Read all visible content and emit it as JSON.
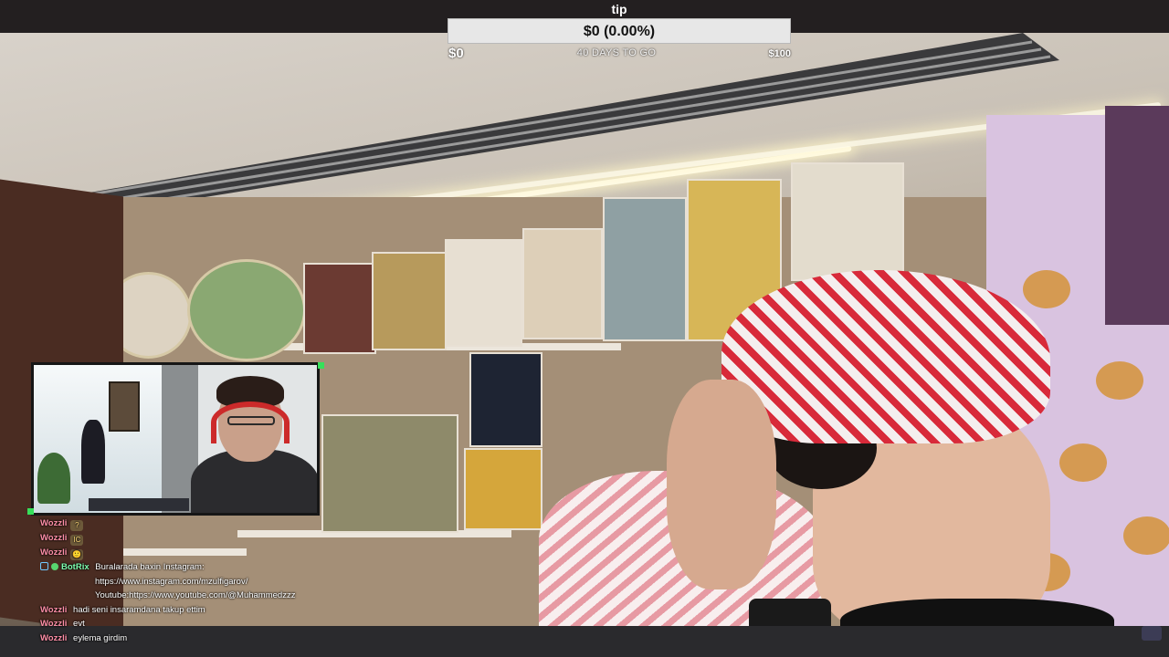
{
  "tip_goal": {
    "title": "tip",
    "progress_text": "$0 (0.00%)",
    "progress_fraction": 0.0,
    "start_label": "$0",
    "days_label": "40 DAYS TO GO",
    "goal_label": "$100",
    "bar_fill_color": "#8f8fff"
  },
  "webcam": {
    "border_accent_color": "#36e05a"
  },
  "chat": {
    "messages": [
      {
        "user": "Wozzli",
        "text": "",
        "emote": "?"
      },
      {
        "user": "Wozzli",
        "text": "",
        "emote": "IC"
      },
      {
        "user": "Wozzli",
        "text": "",
        "emote": "🙂"
      },
      {
        "user": "BotRix",
        "text": "Buralarada baxin Instagram:",
        "is_bot": true
      },
      {
        "user": "",
        "text": "https://www.instagram.com/mzulfigarov/"
      },
      {
        "user": "",
        "text": "Youtube:https://www.youtube.com/@Muhammedzzz"
      },
      {
        "user": "Wozzli",
        "text": "hadi seni insaramdana takup ettim"
      },
      {
        "user": "Wozzli",
        "text": "evt"
      },
      {
        "user": "Wozzli",
        "text": "eylema girdim"
      }
    ]
  }
}
